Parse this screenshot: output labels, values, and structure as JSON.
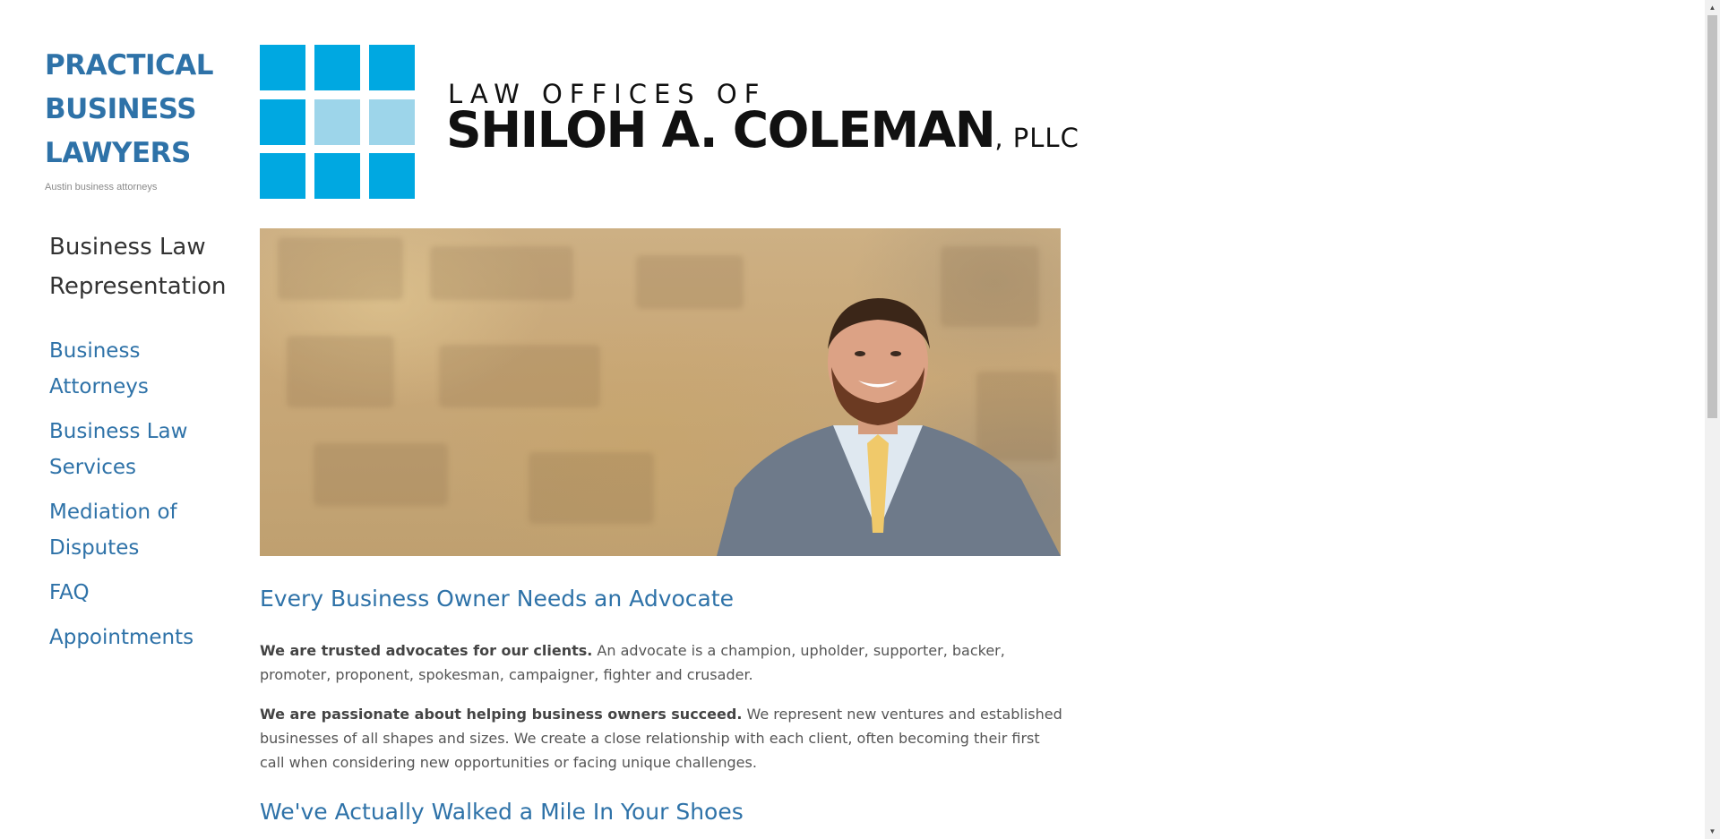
{
  "site": {
    "title": "PRACTICAL BUSINESS LAWYERS",
    "tagline": "Austin business attorneys"
  },
  "nav": {
    "current": "Business Law Representation",
    "items": [
      {
        "label": "Business Attorneys"
      },
      {
        "label": "Business Law Services"
      },
      {
        "label": "Mediation of Disputes"
      },
      {
        "label": "FAQ"
      },
      {
        "label": "Appointments"
      }
    ]
  },
  "logo": {
    "line1": "LAW OFFICES OF",
    "line2": "SHILOH A. COLEMAN",
    "suffix": ", PLLC"
  },
  "content": {
    "heading1": "Every Business Owner Needs an Advocate",
    "p1_bold": "We are trusted advocates for our clients.",
    "p1_text": "  An advocate is a champion, upholder, supporter, backer, promoter, proponent, spokesman, campaigner, fighter and crusader.",
    "p2_bold": "We are passionate about helping business owners succeed.",
    "p2_text": "  We represent new ventures and established businesses of all shapes and sizes.  We create a close relationship with each client, often becoming their first call when considering new opportunities or facing unique challenges.",
    "heading2": "We've Actually Walked a Mile In Your Shoes"
  },
  "colors": {
    "accent": "#2e72a8",
    "logo_blue": "#00a8e1",
    "logo_light_blue": "#9dd5ea"
  }
}
